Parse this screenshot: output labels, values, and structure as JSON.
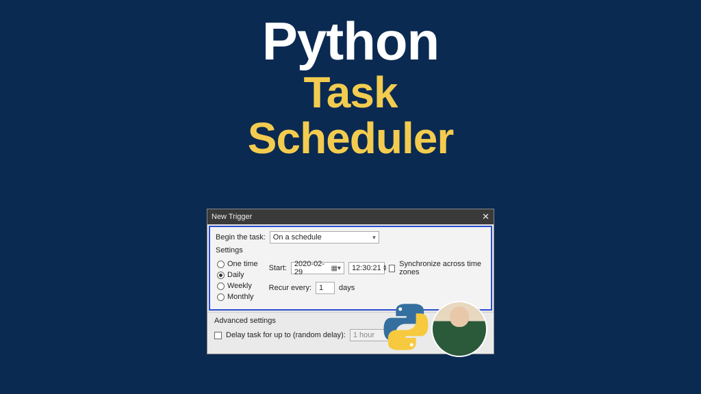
{
  "title": {
    "line1": "Python",
    "line2": "Task",
    "line3": "Scheduler"
  },
  "dialog": {
    "title": "New Trigger",
    "begin_label": "Begin the task:",
    "begin_value": "On a schedule",
    "settings_heading": "Settings",
    "radios": {
      "one_time": "One time",
      "daily": "Daily",
      "weekly": "Weekly",
      "monthly": "Monthly",
      "selected": "daily"
    },
    "start_label": "Start:",
    "start_date": "2020-02-29",
    "start_time": "12:30:21",
    "sync_label": "Synchronize across time zones",
    "recur_label": "Recur every:",
    "recur_value": "1",
    "recur_unit": "days",
    "advanced_heading": "Advanced settings",
    "delay_label": "Delay task for up to (random delay):",
    "delay_value": "1 hour"
  }
}
